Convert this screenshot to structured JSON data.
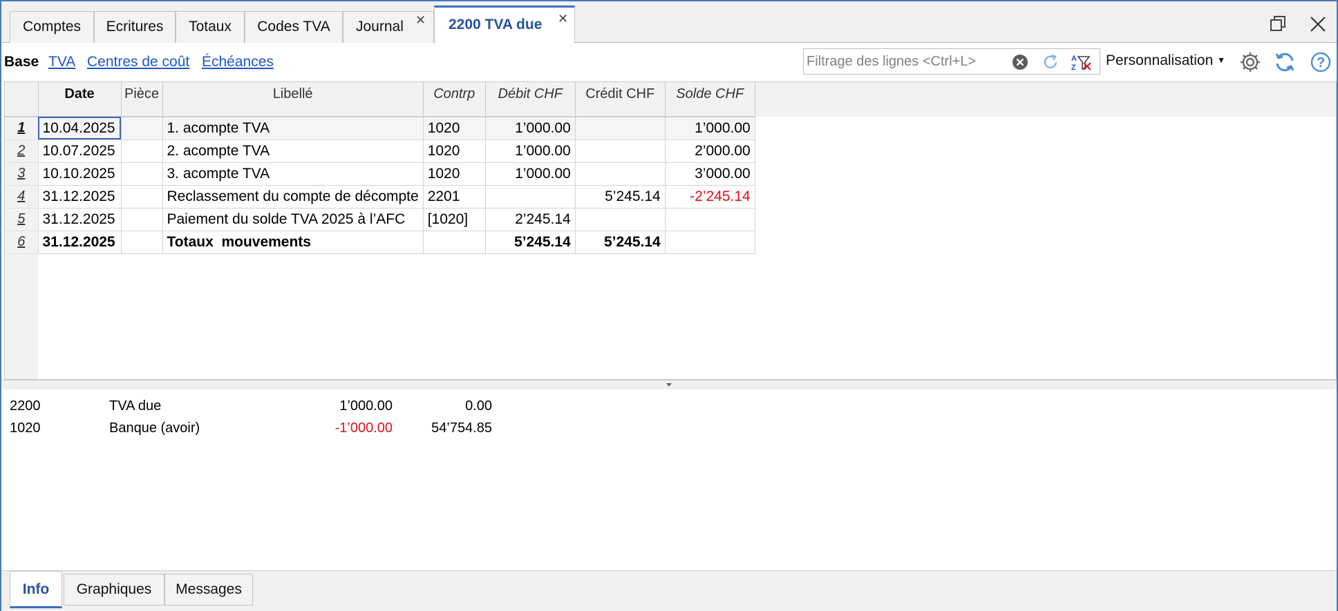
{
  "tabs": [
    {
      "label": "Comptes",
      "closable": false,
      "active": false
    },
    {
      "label": "Ecritures",
      "closable": false,
      "active": false
    },
    {
      "label": "Totaux",
      "closable": false,
      "active": false
    },
    {
      "label": "Codes TVA",
      "closable": false,
      "active": false
    },
    {
      "label": "Journal",
      "closable": true,
      "active": false
    },
    {
      "label": "2200 TVA due",
      "closable": true,
      "active": true
    }
  ],
  "views": {
    "base": "Base",
    "links": [
      "TVA",
      "Centres de coût",
      "Échéances"
    ]
  },
  "filter": {
    "placeholder": "Filtrage des lignes <Ctrl+L>",
    "value": ""
  },
  "personalize_label": "Personnalisation",
  "icons": {
    "clear": "clear-circle-icon",
    "refresh_filter": "refresh-icon",
    "sort_filter": "az-filter-icon",
    "settings": "gear-icon",
    "sync": "sync-icon",
    "help": "help-icon",
    "restore": "restore-window-icon",
    "close": "close-window-icon"
  },
  "grid": {
    "columns": [
      "Date",
      "Pièce",
      "Libellé",
      "Contrp",
      "Débit CHF",
      "Crédit CHF",
      "Solde CHF"
    ],
    "rows": [
      {
        "n": "1",
        "date": "10.04.2025",
        "piece": "",
        "libelle": "1. acompte TVA",
        "contrp": "1020",
        "debit": "1’000.00",
        "credit": "",
        "solde": "1’000.00",
        "neg": false
      },
      {
        "n": "2",
        "date": "10.07.2025",
        "piece": "",
        "libelle": "2. acompte TVA",
        "contrp": "1020",
        "debit": "1’000.00",
        "credit": "",
        "solde": "2’000.00",
        "neg": false
      },
      {
        "n": "3",
        "date": "10.10.2025",
        "piece": "",
        "libelle": "3. acompte TVA",
        "contrp": "1020",
        "debit": "1’000.00",
        "credit": "",
        "solde": "3’000.00",
        "neg": false
      },
      {
        "n": "4",
        "date": "31.12.2025",
        "piece": "",
        "libelle": "Reclassement du compte de décompte",
        "contrp": "2201",
        "debit": "",
        "credit": "5’245.14",
        "solde": "-2’245.14",
        "neg": true
      },
      {
        "n": "5",
        "date": "31.12.2025",
        "piece": "",
        "libelle": "Paiement du solde TVA 2025 à l’AFC",
        "contrp": "[1020]",
        "debit": "2’245.14",
        "credit": "",
        "solde": "",
        "neg": false
      },
      {
        "n": "6",
        "date": "31.12.2025",
        "piece": "",
        "libelle": "Totaux  mouvements",
        "contrp": "",
        "debit": "5’245.14",
        "credit": "5’245.14",
        "solde": "",
        "neg": false,
        "total": true
      }
    ]
  },
  "info": [
    {
      "account": "2200",
      "name": "TVA due",
      "amount": "1’000.00",
      "balance": "0.00",
      "amount_neg": false
    },
    {
      "account": "1020",
      "name": "Banque (avoir)",
      "amount": "-1’000.00",
      "balance": "54’754.85",
      "amount_neg": true
    }
  ],
  "bottom_tabs": [
    {
      "label": "Info",
      "active": true
    },
    {
      "label": "Graphiques",
      "active": false
    },
    {
      "label": "Messages",
      "active": false
    }
  ],
  "colors": {
    "accent": "#3c6fbf",
    "link": "#1d56c7",
    "negative": "#e2101a"
  }
}
